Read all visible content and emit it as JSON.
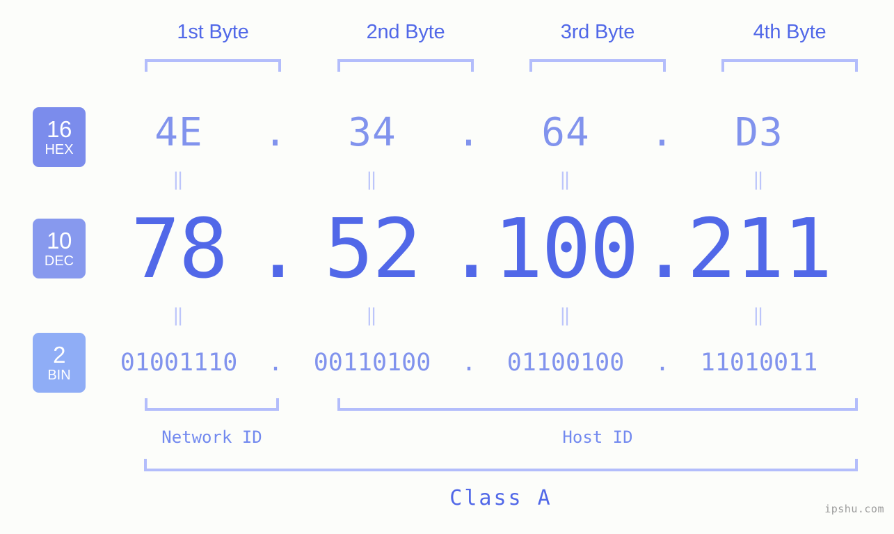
{
  "background_color": "#fcfdfa",
  "accent": {
    "strong_blue": "#5168e8",
    "light_blue": "#8193ed",
    "bracket": "#b3bdfb",
    "eq_marker": "#bcc5fa",
    "badge_hex": "#7b8cec",
    "badge_dec": "#8799ee",
    "badge_bin": "#8fadf6",
    "watermark": "#9a9a9a"
  },
  "byte_headers": [
    {
      "label": "1st Byte"
    },
    {
      "label": "2nd Byte"
    },
    {
      "label": "3rd Byte"
    },
    {
      "label": "4th Byte"
    }
  ],
  "radix_badges": [
    {
      "number": "16",
      "abbr": "HEX"
    },
    {
      "number": "10",
      "abbr": "DEC"
    },
    {
      "number": "2",
      "abbr": "BIN"
    }
  ],
  "rows": {
    "hex": {
      "radix": "16",
      "name": "HEX",
      "separator": ".",
      "bytes": [
        "4E",
        "34",
        "64",
        "D3"
      ]
    },
    "dec": {
      "radix": "10",
      "name": "DEC",
      "separator": ".",
      "bytes": [
        "78",
        "52",
        "100",
        "211"
      ]
    },
    "bin": {
      "radix": "2",
      "name": "BIN",
      "separator": ".",
      "bytes": [
        "01001110",
        "00110100",
        "01100100",
        "11010011"
      ]
    }
  },
  "equality_marker": "‖",
  "segments": [
    {
      "label": "Network ID"
    },
    {
      "label": "Host ID"
    }
  ],
  "address_class": {
    "label": "Class A"
  },
  "watermark": {
    "text": "ipshu.com"
  }
}
